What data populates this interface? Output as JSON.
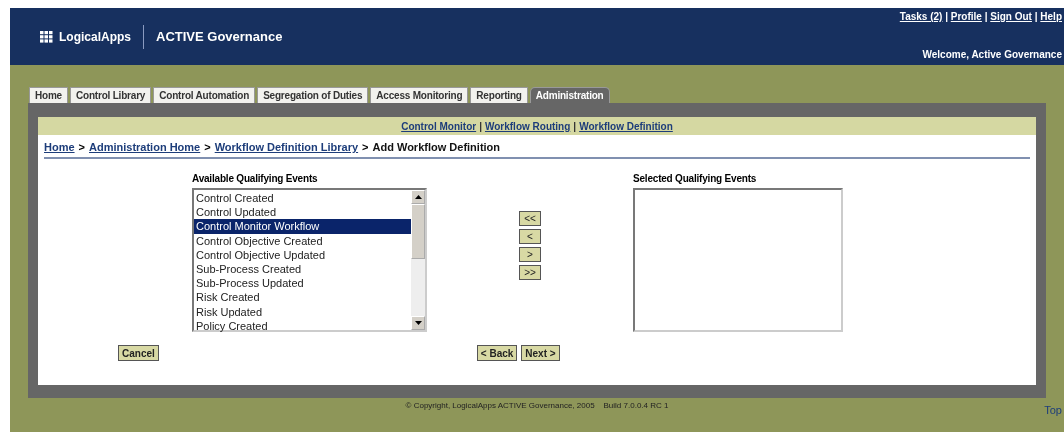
{
  "header": {
    "logo": "LogicalApps",
    "product": "ACTIVE Governance",
    "links": [
      "Tasks (2)",
      "Profile",
      "Sign Out",
      "Help"
    ],
    "separator": "|",
    "welcome": "Welcome, Active Governance"
  },
  "tabs": [
    {
      "label": "Home",
      "selected": false
    },
    {
      "label": "Control Library",
      "selected": false
    },
    {
      "label": "Control Automation",
      "selected": false
    },
    {
      "label": "Segregation of Duties",
      "selected": false
    },
    {
      "label": "Access Monitoring",
      "selected": false
    },
    {
      "label": "Reporting",
      "selected": false
    },
    {
      "label": "Administration",
      "selected": true
    }
  ],
  "subnav": {
    "links": [
      "Control Monitor",
      "Workflow Routing",
      "Workflow Definition"
    ],
    "separator": "|"
  },
  "breadcrumb": {
    "separator": ">",
    "links": [
      "Home",
      "Administration Home",
      "Workflow Definition Library"
    ],
    "current": "Add Workflow Definition"
  },
  "available": {
    "title": "Available Qualifying Events",
    "items": [
      {
        "label": "Control Created",
        "selected": false
      },
      {
        "label": "Control Updated",
        "selected": false
      },
      {
        "label": "Control Monitor Workflow",
        "selected": true
      },
      {
        "label": "Control Objective Created",
        "selected": false
      },
      {
        "label": "Control Objective Updated",
        "selected": false
      },
      {
        "label": "Sub-Process Created",
        "selected": false
      },
      {
        "label": "Sub-Process Updated",
        "selected": false
      },
      {
        "label": "Risk Created",
        "selected": false
      },
      {
        "label": "Risk Updated",
        "selected": false
      },
      {
        "label": "Policy Created",
        "selected": false
      }
    ]
  },
  "move_buttons": [
    "<<",
    "<",
    ">",
    ">>"
  ],
  "selected_events": {
    "title": "Selected Qualifying Events"
  },
  "buttons": {
    "cancel": "Cancel",
    "back": "< Back",
    "next": "Next >"
  },
  "footer": {
    "copyright": "© Copyright, LogicalApps ACTIVE Governance, 2005    Build 7.0.0.4 RC 1",
    "top": "Top"
  }
}
